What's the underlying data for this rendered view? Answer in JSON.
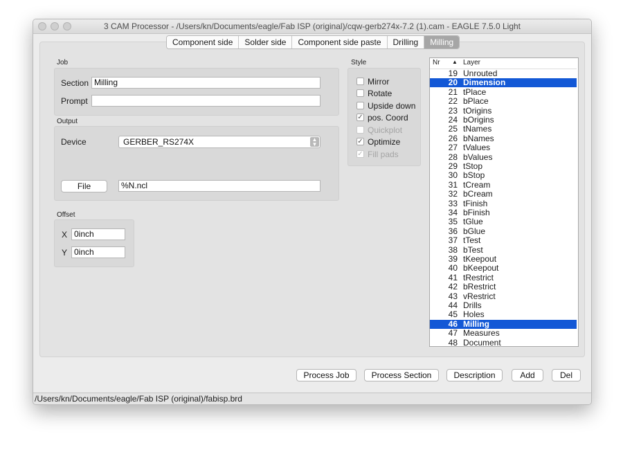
{
  "window": {
    "title": "3 CAM Processor - /Users/kn/Documents/eagle/Fab ISP (original)/cqw-gerb274x-7.2 (1).cam - EAGLE 7.5.0 Light"
  },
  "tabs": [
    {
      "label": "Component side"
    },
    {
      "label": "Solder side"
    },
    {
      "label": "Component side paste"
    },
    {
      "label": "Drilling"
    },
    {
      "label": "Milling"
    }
  ],
  "job": {
    "group_label": "Job",
    "section_label": "Section",
    "section_value": "Milling",
    "prompt_label": "Prompt",
    "prompt_value": ""
  },
  "output": {
    "group_label": "Output",
    "device_label": "Device",
    "device_value": "GERBER_RS274X",
    "file_button": "File",
    "file_value": "%N.ncl"
  },
  "offset": {
    "group_label": "Offset",
    "x_label": "X",
    "x_value": "0inch",
    "y_label": "Y",
    "y_value": "0inch"
  },
  "style": {
    "group_label": "Style",
    "options": [
      {
        "label": "Mirror",
        "checked": false,
        "disabled": false
      },
      {
        "label": "Rotate",
        "checked": false,
        "disabled": false
      },
      {
        "label": "Upside down",
        "checked": false,
        "disabled": false
      },
      {
        "label": "pos. Coord",
        "checked": true,
        "disabled": false
      },
      {
        "label": "Quickplot",
        "checked": false,
        "disabled": true
      },
      {
        "label": "Optimize",
        "checked": true,
        "disabled": false
      },
      {
        "label": "Fill pads",
        "checked": true,
        "disabled": true
      }
    ]
  },
  "layers": {
    "header_nr": "Nr",
    "header_sort": "▲",
    "header_layer": "Layer",
    "rows": [
      {
        "nr": "19",
        "name": "Unrouted",
        "selected": false
      },
      {
        "nr": "20",
        "name": "Dimension",
        "selected": true
      },
      {
        "nr": "21",
        "name": "tPlace",
        "selected": false
      },
      {
        "nr": "22",
        "name": "bPlace",
        "selected": false
      },
      {
        "nr": "23",
        "name": "tOrigins",
        "selected": false
      },
      {
        "nr": "24",
        "name": "bOrigins",
        "selected": false
      },
      {
        "nr": "25",
        "name": "tNames",
        "selected": false
      },
      {
        "nr": "26",
        "name": "bNames",
        "selected": false
      },
      {
        "nr": "27",
        "name": "tValues",
        "selected": false
      },
      {
        "nr": "28",
        "name": "bValues",
        "selected": false
      },
      {
        "nr": "29",
        "name": "tStop",
        "selected": false
      },
      {
        "nr": "30",
        "name": "bStop",
        "selected": false
      },
      {
        "nr": "31",
        "name": "tCream",
        "selected": false
      },
      {
        "nr": "32",
        "name": "bCream",
        "selected": false
      },
      {
        "nr": "33",
        "name": "tFinish",
        "selected": false
      },
      {
        "nr": "34",
        "name": "bFinish",
        "selected": false
      },
      {
        "nr": "35",
        "name": "tGlue",
        "selected": false
      },
      {
        "nr": "36",
        "name": "bGlue",
        "selected": false
      },
      {
        "nr": "37",
        "name": "tTest",
        "selected": false
      },
      {
        "nr": "38",
        "name": "bTest",
        "selected": false
      },
      {
        "nr": "39",
        "name": "tKeepout",
        "selected": false
      },
      {
        "nr": "40",
        "name": "bKeepout",
        "selected": false
      },
      {
        "nr": "41",
        "name": "tRestrict",
        "selected": false
      },
      {
        "nr": "42",
        "name": "bRestrict",
        "selected": false
      },
      {
        "nr": "43",
        "name": "vRestrict",
        "selected": false
      },
      {
        "nr": "44",
        "name": "Drills",
        "selected": false
      },
      {
        "nr": "45",
        "name": "Holes",
        "selected": false
      },
      {
        "nr": "46",
        "name": "Milling",
        "selected": true
      },
      {
        "nr": "47",
        "name": "Measures",
        "selected": false
      },
      {
        "nr": "48",
        "name": "Document",
        "selected": false
      }
    ]
  },
  "buttons": {
    "process_job": "Process Job",
    "process_section": "Process Section",
    "description": "Description",
    "add": "Add",
    "del": "Del"
  },
  "status": {
    "path": "/Users/kn/Documents/eagle/Fab ISP (original)/fabisp.brd"
  },
  "icons": {
    "checkmark": "checkmark-icon",
    "select_arrows": "updown-arrows-icon",
    "window_controls": "traffic-light-icon"
  },
  "colors": {
    "selection": "#1358d6",
    "active_tab": "#a6a6a6",
    "window_bg": "#ececec"
  }
}
